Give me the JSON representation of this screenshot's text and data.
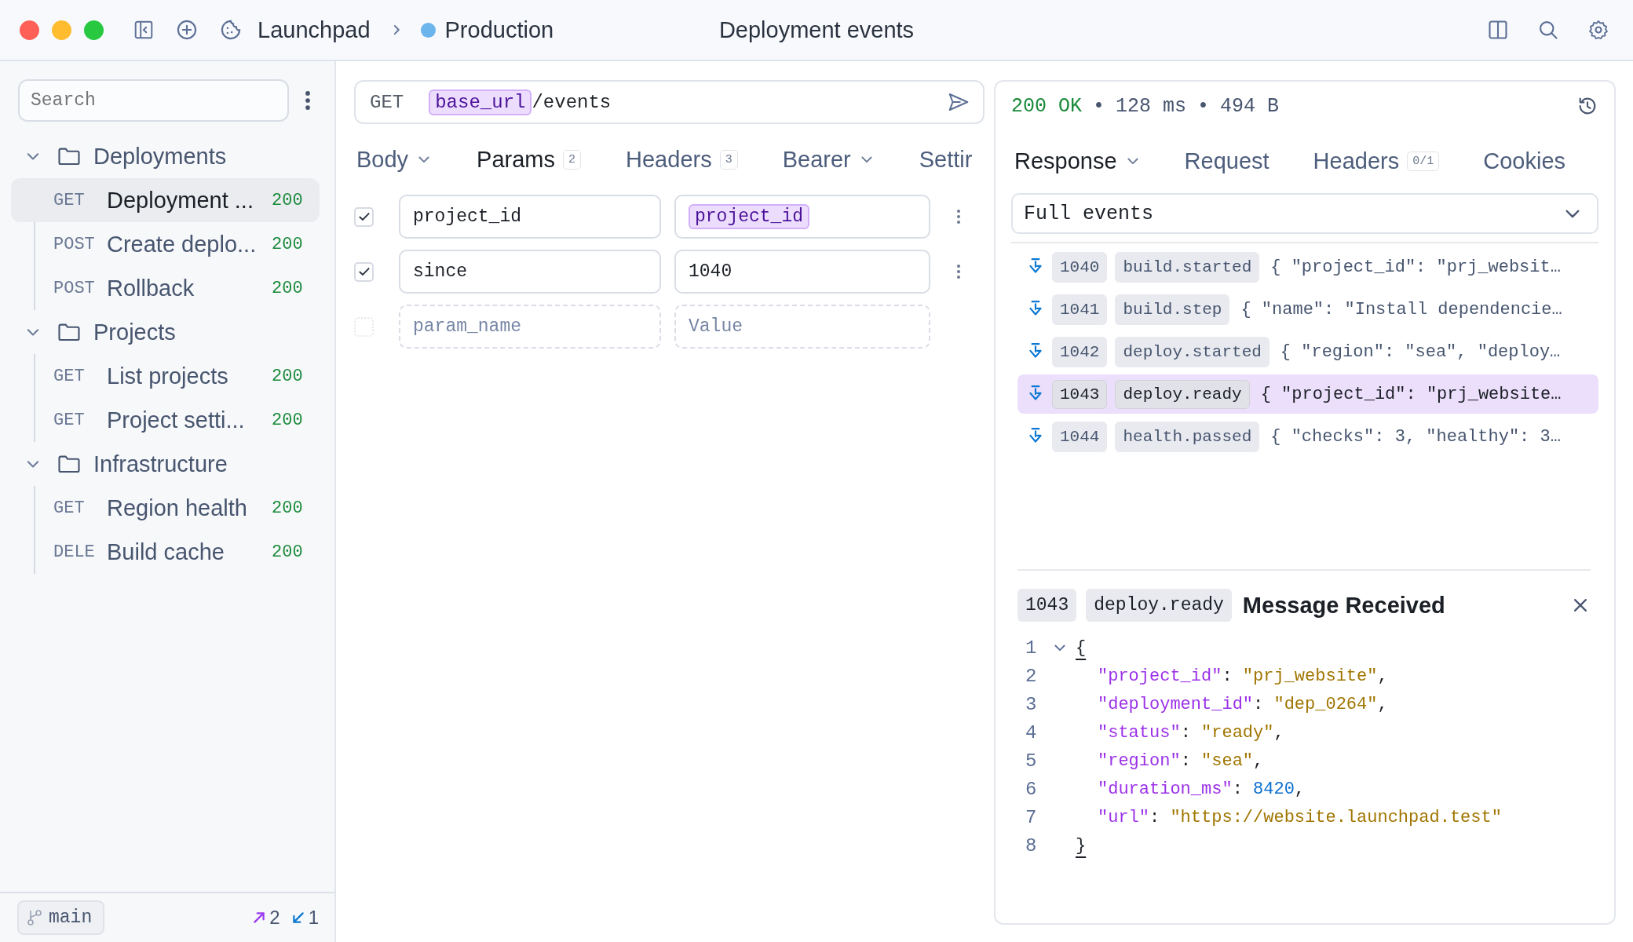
{
  "topbar": {
    "workspace": "Launchpad",
    "environment": "Production",
    "title": "Deployment events"
  },
  "sidebar": {
    "search": {
      "placeholder": "Search"
    },
    "folders": [
      {
        "name": "Deployments",
        "expanded": true,
        "children": [
          {
            "method": "GET",
            "name": "Deployment ...",
            "status": "200",
            "selected": true
          },
          {
            "method": "POST",
            "name": "Create deplo...",
            "status": "200",
            "selected": false
          },
          {
            "method": "POST",
            "name": "Rollback",
            "status": "200",
            "selected": false
          }
        ]
      },
      {
        "name": "Projects",
        "expanded": true,
        "children": [
          {
            "method": "GET",
            "name": "List projects",
            "status": "200",
            "selected": false
          },
          {
            "method": "GET",
            "name": "Project setti...",
            "status": "200",
            "selected": false
          }
        ]
      },
      {
        "name": "Infrastructure",
        "expanded": true,
        "children": [
          {
            "method": "GET",
            "name": "Region health",
            "status": "200",
            "selected": false
          },
          {
            "method": "DELE",
            "name": "Build cache",
            "status": "200",
            "selected": false
          }
        ]
      }
    ],
    "branch": "main",
    "ahead": "2",
    "behind": "1"
  },
  "request": {
    "method": "GET",
    "url_variable": "base_url",
    "url_path": "/events",
    "tabs": [
      {
        "label": "Body",
        "dropdown": true,
        "selected": false
      },
      {
        "label": "Params",
        "badge": "2",
        "selected": true
      },
      {
        "label": "Headers",
        "badge": "3",
        "selected": false
      },
      {
        "label": "Bearer",
        "dropdown": true,
        "selected": false
      },
      {
        "label": "Settir",
        "selected": false
      }
    ],
    "params": [
      {
        "checked": true,
        "name": "project_id",
        "value": "project_id",
        "kind": "variable"
      },
      {
        "checked": true,
        "name": "since",
        "value": "1040",
        "kind": "text"
      }
    ],
    "new_param": {
      "checked": false,
      "name_placeholder": "param_name",
      "value_placeholder": "Value"
    }
  },
  "response": {
    "status": "200 OK",
    "time": "128 ms",
    "size": "494 B",
    "separator": "•",
    "tabs": [
      {
        "label": "Response",
        "dropdown": true,
        "selected": true
      },
      {
        "label": "Request",
        "selected": false
      },
      {
        "label": "Headers",
        "badge": "0/1",
        "selected": false
      },
      {
        "label": "Cookies",
        "selected": false
      }
    ],
    "filter": "Full events",
    "events": [
      {
        "id": "1040",
        "name": "build.started",
        "preview": "{ \"project_id\": \"prj_websit…",
        "selected": false
      },
      {
        "id": "1041",
        "name": "build.step",
        "preview": "{ \"name\": \"Install dependencie…",
        "selected": false
      },
      {
        "id": "1042",
        "name": "deploy.started",
        "preview": "{ \"region\": \"sea\", \"deploy…",
        "selected": false
      },
      {
        "id": "1043",
        "name": "deploy.ready",
        "preview": "{ \"project_id\": \"prj_website…",
        "selected": true
      },
      {
        "id": "1044",
        "name": "health.passed",
        "preview": "{ \"checks\": 3, \"healthy\": 3…",
        "selected": false
      }
    ],
    "detail": {
      "id": "1043",
      "name": "deploy.ready",
      "title": "Message Received",
      "lines": [
        {
          "number": "1",
          "kind": "brace",
          "expanded": true,
          "tokens": [
            {
              "kind": "punct",
              "text": "{"
            }
          ]
        },
        {
          "number": "2",
          "kind": "entry",
          "tokens": [
            {
              "kind": "key",
              "text": "\"project_id\""
            },
            {
              "kind": "punct",
              "text": ": "
            },
            {
              "kind": "string",
              "text": "\"prj_website\""
            },
            {
              "kind": "punct",
              "text": ","
            }
          ]
        },
        {
          "number": "3",
          "kind": "entry",
          "tokens": [
            {
              "kind": "key",
              "text": "\"deployment_id\""
            },
            {
              "kind": "punct",
              "text": ": "
            },
            {
              "kind": "string",
              "text": "\"dep_0264\""
            },
            {
              "kind": "punct",
              "text": ","
            }
          ]
        },
        {
          "number": "4",
          "kind": "entry",
          "tokens": [
            {
              "kind": "key",
              "text": "\"status\""
            },
            {
              "kind": "punct",
              "text": ": "
            },
            {
              "kind": "string",
              "text": "\"ready\""
            },
            {
              "kind": "punct",
              "text": ","
            }
          ]
        },
        {
          "number": "5",
          "kind": "entry",
          "tokens": [
            {
              "kind": "key",
              "text": "\"region\""
            },
            {
              "kind": "punct",
              "text": ": "
            },
            {
              "kind": "string",
              "text": "\"sea\""
            },
            {
              "kind": "punct",
              "text": ","
            }
          ]
        },
        {
          "number": "6",
          "kind": "entry",
          "tokens": [
            {
              "kind": "key",
              "text": "\"duration_ms\""
            },
            {
              "kind": "punct",
              "text": ": "
            },
            {
              "kind": "number",
              "text": "8420"
            },
            {
              "kind": "punct",
              "text": ","
            }
          ]
        },
        {
          "number": "7",
          "kind": "entry",
          "tokens": [
            {
              "kind": "key",
              "text": "\"url\""
            },
            {
              "kind": "punct",
              "text": ": "
            },
            {
              "kind": "string",
              "text": "\"https://website.launchpad.test\""
            }
          ]
        },
        {
          "number": "8",
          "kind": "brace",
          "tokens": [
            {
              "kind": "punct",
              "text": "}"
            }
          ]
        }
      ]
    }
  }
}
